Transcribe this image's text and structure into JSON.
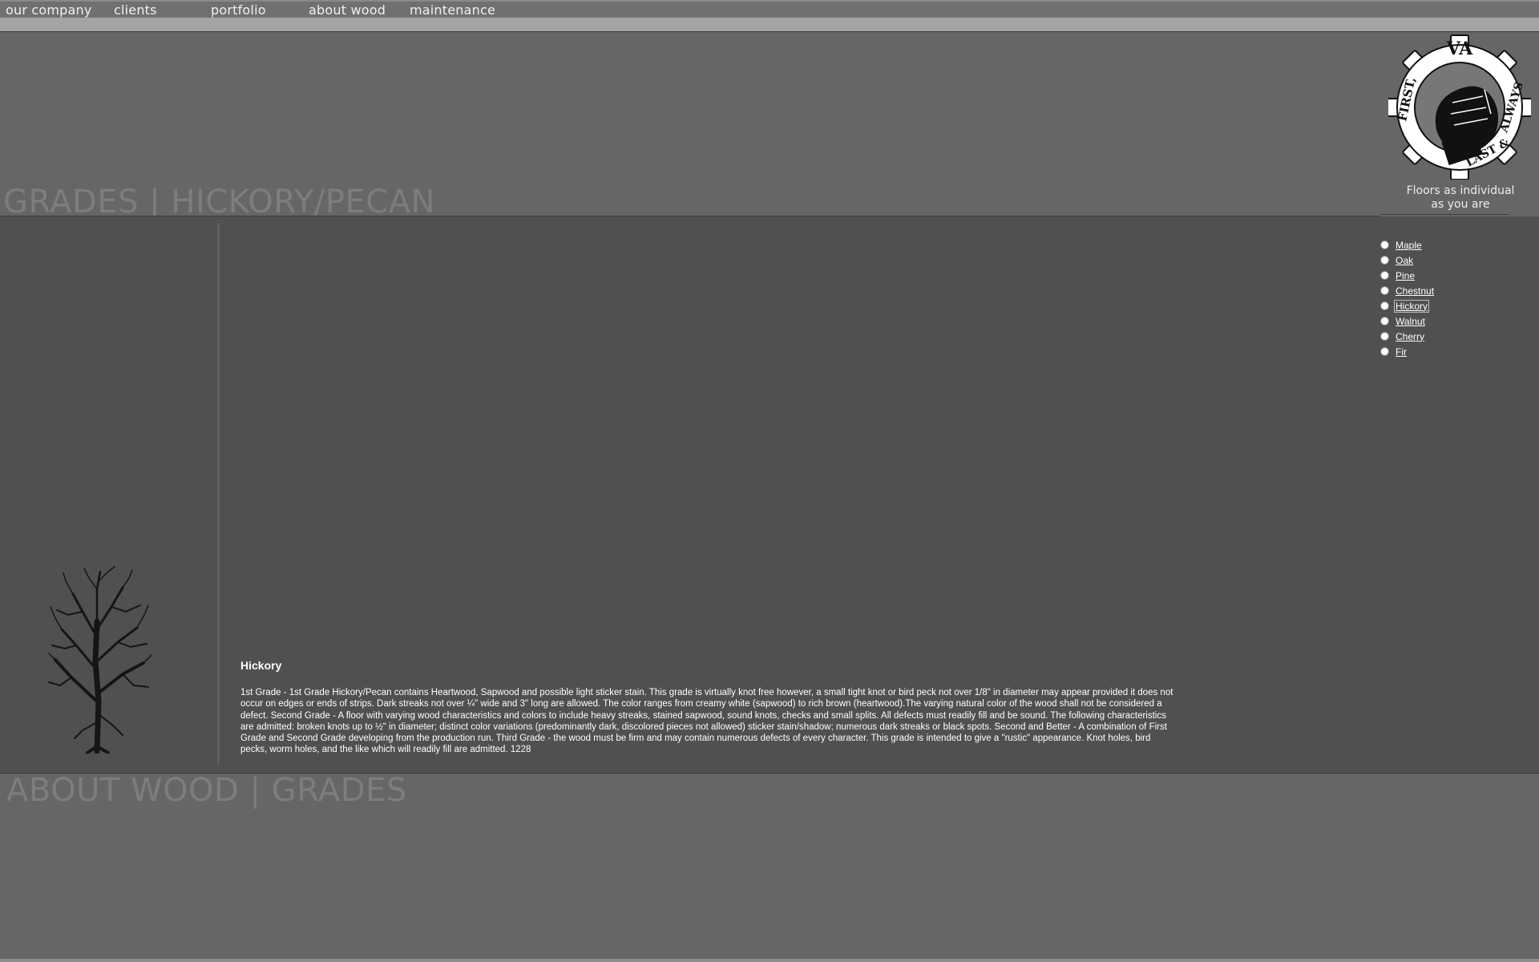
{
  "nav": {
    "items": [
      "our company",
      "clients",
      "portfolio",
      "about wood",
      "maintenance"
    ]
  },
  "header": {
    "title": "GRADES | HICKORY/PECAN",
    "tagline_line1": "Floors as individual",
    "tagline_line2": "as you are"
  },
  "logo": {
    "text": "FIRST, LAST & ALWAYS"
  },
  "wood_list": {
    "items": [
      "Maple",
      "Oak",
      "Pine",
      "Chestnut",
      "Hickory",
      "Walnut",
      "Cherry",
      "Fir"
    ],
    "selected": "Hickory"
  },
  "content": {
    "title": "Hickory",
    "body": "1st Grade - 1st Grade Hickory/Pecan contains Heartwood, Sapwood and possible light sticker stain. This grade is virtually knot free however, a small tight knot or bird peck not over 1/8\" in diameter may appear provided it does not occur on edges or ends of strips. Dark streaks not over ¼\" wide and 3\" long are allowed. The color ranges from creamy white (sapwood) to rich brown (heartwood).The varying natural color of the wood shall not be considered a defect. Second Grade - A floor with varying wood characteristics and colors to include heavy streaks, stained sapwood, sound knots, checks and small splits. All defects must readily fill and be sound. The following characteristics are admitted: broken knots up to ½\" in diameter; distinct color variations (predominantly dark, discolored pieces not allowed) sticker stain/shadow; numerous dark streaks or black spots. Second and Better - A combination of First Grade and Second Grade developing from the production run. Third Grade - the wood must be firm and may contain numerous defects of every character. This grade is intended to give a \"rustic\" appearance. Knot holes, bird pecks, worm holes, and the like which will readily fill are admitted. 1228"
  },
  "footer": {
    "title": "ABOUT WOOD | GRADES"
  },
  "colors": {
    "background": "#666666",
    "content_bg": "#505050",
    "nav_bar": "#707070",
    "sub_bar": "#a4a4a4",
    "title_text": "#7d7d7d"
  },
  "icons": {
    "logo": "fist-gear-logo-icon",
    "tree": "bare-tree-icon",
    "radio": "radio-button-icon"
  }
}
